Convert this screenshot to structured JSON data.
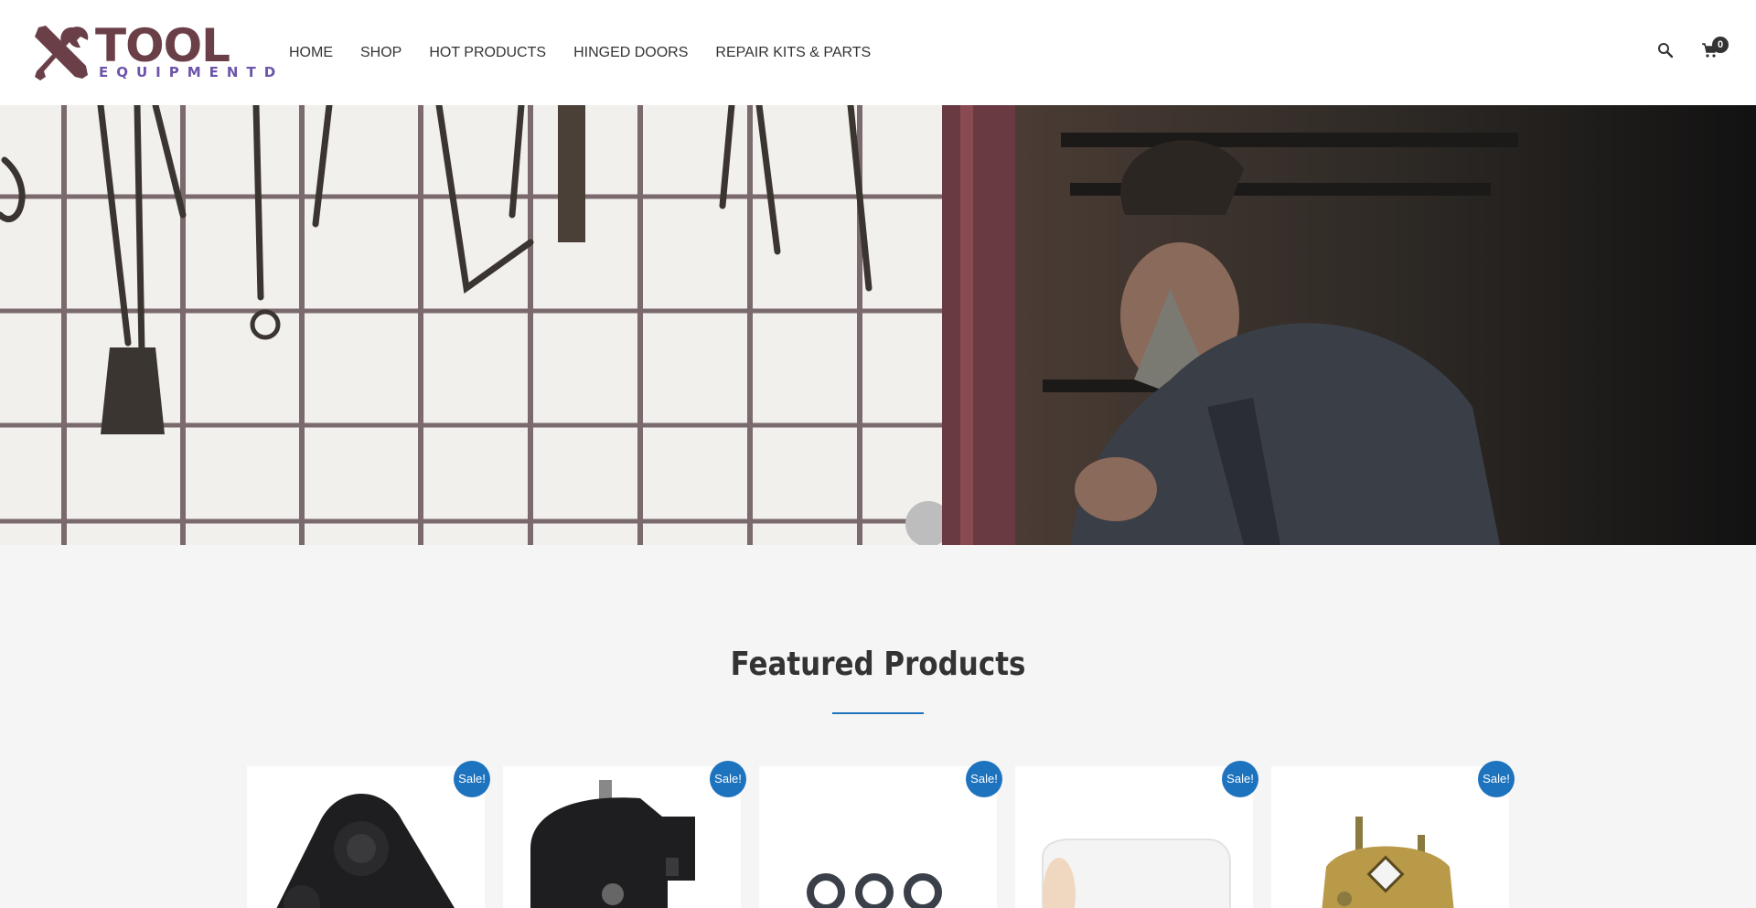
{
  "site": {
    "logo_word": "TOOL",
    "logo_sub": "EQUIPMENTD"
  },
  "nav": {
    "items": [
      {
        "label": "HOME"
      },
      {
        "label": "SHOP"
      },
      {
        "label": "HOT PRODUCTS"
      },
      {
        "label": "HINGED DOORS"
      },
      {
        "label": "REPAIR KITS & PARTS"
      }
    ]
  },
  "header_icons": {
    "search": "search-icon",
    "cart": "cart-icon",
    "cart_count": "0"
  },
  "featured": {
    "title": "Featured Products",
    "products": [
      {
        "badge": "Sale!",
        "image": "black-motor-housing"
      },
      {
        "badge": "Sale!",
        "image": "black-actuator"
      },
      {
        "badge": "Sale!",
        "image": "rubber-o-rings"
      },
      {
        "badge": "Sale!",
        "image": "white-roller"
      },
      {
        "badge": "Sale!",
        "image": "brass-hinge-mechanism"
      }
    ]
  },
  "colors": {
    "accent": "#1e73be",
    "logo": "#6b3f48",
    "logo_sub": "#6c55a8",
    "background": "#f5f5f5"
  }
}
